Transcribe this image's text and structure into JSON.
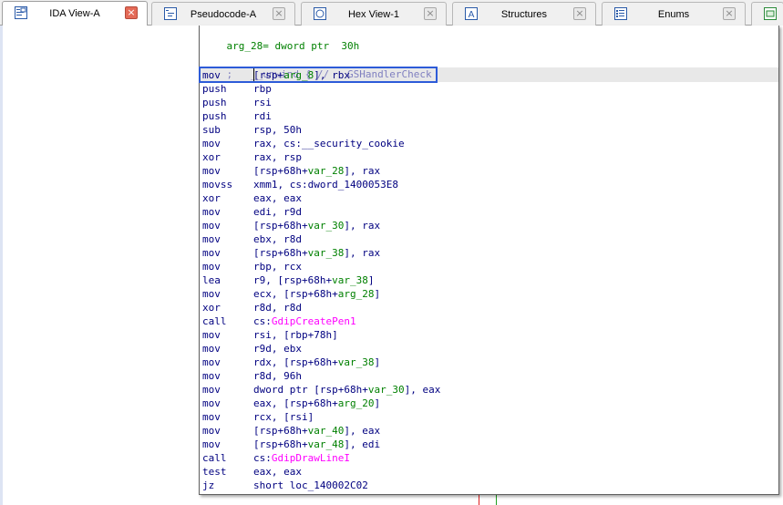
{
  "tabs": [
    {
      "label": "IDA View-A",
      "icon": "ida-view-icon",
      "active": true
    },
    {
      "label": "Pseudocode-A",
      "icon": "pseudocode-icon",
      "active": false
    },
    {
      "label": "Hex View-1",
      "icon": "hex-view-icon",
      "active": false
    },
    {
      "label": "Structures",
      "icon": "structures-icon",
      "active": false
    },
    {
      "label": "Enums",
      "icon": "enums-icon",
      "active": false
    },
    {
      "label": "",
      "icon": "imports-icon",
      "active": false
    }
  ],
  "code": {
    "header_line": "arg_28= dword ptr  30h",
    "unwind_line": ";   __unwind { //   GSHandlerCheck",
    "instructions": [
      {
        "mnemonic": "mov",
        "parts": [
          [
            "[rsp+",
            "r"
          ],
          [
            "arg_8",
            "v"
          ],
          [
            "], rbx",
            "r"
          ]
        ]
      },
      {
        "mnemonic": "push",
        "parts": [
          [
            "rbp",
            "r"
          ]
        ]
      },
      {
        "mnemonic": "push",
        "parts": [
          [
            "rsi",
            "r"
          ]
        ]
      },
      {
        "mnemonic": "push",
        "parts": [
          [
            "rdi",
            "r"
          ]
        ]
      },
      {
        "mnemonic": "sub",
        "parts": [
          [
            "rsp, 50h",
            "r"
          ]
        ]
      },
      {
        "mnemonic": "mov",
        "parts": [
          [
            "rax, cs:__security_cookie",
            "r"
          ]
        ]
      },
      {
        "mnemonic": "xor",
        "parts": [
          [
            "rax, rsp",
            "r"
          ]
        ]
      },
      {
        "mnemonic": "mov",
        "parts": [
          [
            "[rsp+68h+",
            "r"
          ],
          [
            "var_28",
            "v"
          ],
          [
            "], rax",
            "r"
          ]
        ]
      },
      {
        "mnemonic": "movss",
        "parts": [
          [
            "xmm1, cs:dword_1400053E8",
            "r"
          ]
        ]
      },
      {
        "mnemonic": "xor",
        "parts": [
          [
            "eax, eax",
            "r"
          ]
        ]
      },
      {
        "mnemonic": "mov",
        "parts": [
          [
            "edi, r9d",
            "r"
          ]
        ]
      },
      {
        "mnemonic": "mov",
        "parts": [
          [
            "[rsp+68h+",
            "r"
          ],
          [
            "var_30",
            "v"
          ],
          [
            "], rax",
            "r"
          ]
        ]
      },
      {
        "mnemonic": "mov",
        "parts": [
          [
            "ebx, r8d",
            "r"
          ]
        ]
      },
      {
        "mnemonic": "mov",
        "parts": [
          [
            "[rsp+68h+",
            "r"
          ],
          [
            "var_38",
            "v"
          ],
          [
            "], rax",
            "r"
          ]
        ]
      },
      {
        "mnemonic": "mov",
        "parts": [
          [
            "rbp, rcx",
            "r"
          ]
        ]
      },
      {
        "mnemonic": "lea",
        "parts": [
          [
            "r9, [rsp+68h+",
            "r"
          ],
          [
            "var_38",
            "v"
          ],
          [
            "]",
            "r"
          ]
        ]
      },
      {
        "mnemonic": "mov",
        "parts": [
          [
            "ecx, [rsp+68h+",
            "r"
          ],
          [
            "arg_28",
            "v"
          ],
          [
            "]",
            "r"
          ]
        ]
      },
      {
        "mnemonic": "xor",
        "parts": [
          [
            "r8d, r8d",
            "r"
          ]
        ]
      },
      {
        "mnemonic": "call",
        "parts": [
          [
            "cs:",
            "r"
          ],
          [
            "GdipCreatePen1",
            "i"
          ]
        ]
      },
      {
        "mnemonic": "mov",
        "parts": [
          [
            "rsi, [rbp+78h]",
            "r"
          ]
        ]
      },
      {
        "mnemonic": "mov",
        "parts": [
          [
            "r9d, ebx",
            "r"
          ]
        ]
      },
      {
        "mnemonic": "mov",
        "parts": [
          [
            "rdx, [rsp+68h+",
            "r"
          ],
          [
            "var_38",
            "v"
          ],
          [
            "]",
            "r"
          ]
        ]
      },
      {
        "mnemonic": "mov",
        "parts": [
          [
            "r8d, 96h",
            "r"
          ]
        ]
      },
      {
        "mnemonic": "mov",
        "parts": [
          [
            "dword ptr [rsp+68h+",
            "r"
          ],
          [
            "var_30",
            "v"
          ],
          [
            "], eax",
            "r"
          ]
        ]
      },
      {
        "mnemonic": "mov",
        "parts": [
          [
            "eax, [rsp+68h+",
            "r"
          ],
          [
            "arg_20",
            "v"
          ],
          [
            "]",
            "r"
          ]
        ]
      },
      {
        "mnemonic": "mov",
        "parts": [
          [
            "rcx, [rsi]",
            "r"
          ]
        ]
      },
      {
        "mnemonic": "mov",
        "parts": [
          [
            "[rsp+68h+",
            "r"
          ],
          [
            "var_40",
            "v"
          ],
          [
            "], eax",
            "r"
          ]
        ]
      },
      {
        "mnemonic": "mov",
        "parts": [
          [
            "[rsp+68h+",
            "r"
          ],
          [
            "var_48",
            "v"
          ],
          [
            "], edi",
            "r"
          ]
        ]
      },
      {
        "mnemonic": "call",
        "parts": [
          [
            "cs:",
            "r"
          ],
          [
            "GdipDrawLineI",
            "i"
          ]
        ]
      },
      {
        "mnemonic": "test",
        "parts": [
          [
            "eax, eax",
            "r"
          ]
        ]
      },
      {
        "mnemonic": "jz",
        "parts": [
          [
            "short loc_140002C02",
            "r"
          ]
        ]
      }
    ]
  },
  "colors": {
    "register": "#000080",
    "variable": "#008000",
    "import": "#ff00ff",
    "comment": "#8080c0",
    "selection_border": "#2d5bd8"
  }
}
